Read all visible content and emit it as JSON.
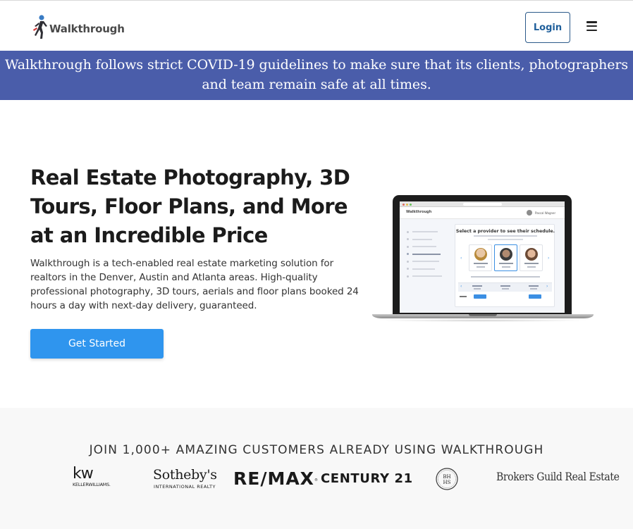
{
  "header": {
    "logo_text": "Walkthrough",
    "login_label": "Login",
    "menu_icon": "hamburger-menu-icon"
  },
  "banner": {
    "text": "Walkthrough follows strict COVID-19 guidelines to make sure that its clients, photographers and team remain safe at all times.",
    "color": "#4a5daa"
  },
  "hero": {
    "title": "Real Estate Photography, 3D Tours, Floor Plans, and More at an Incredible Price",
    "description": "Walkthrough is a tech-enabled real estate marketing solution for realtors in the Denver, Austin and Atlanta areas. High-quality professional photography, 3D tours, aerials and floor plans booked 24 hours a day with next-day delivery, guaranteed.",
    "cta_label": "Get Started",
    "cta_color": "#2f95ee"
  },
  "laptop_screen": {
    "app_logo": "Walkthrough",
    "user_name": "Pascal Wagner",
    "card_title": "Select a provider to see their schedule."
  },
  "customers": {
    "title": "JOIN 1,000+ AMAZING CUSTOMERS ALREADY USING WALKTHROUGH",
    "logos": {
      "kw_big": "kw",
      "kw_small": "KELLERWILLIAMS.",
      "sothebys_big": "Sotheby's",
      "sothebys_small": "INTERNATIONAL REALTY",
      "remax": "RE/MAX",
      "century21": "CENTURY 21",
      "bhhs": "BH HS",
      "brokers_guild": "Brokers Guild Real Estate"
    }
  }
}
